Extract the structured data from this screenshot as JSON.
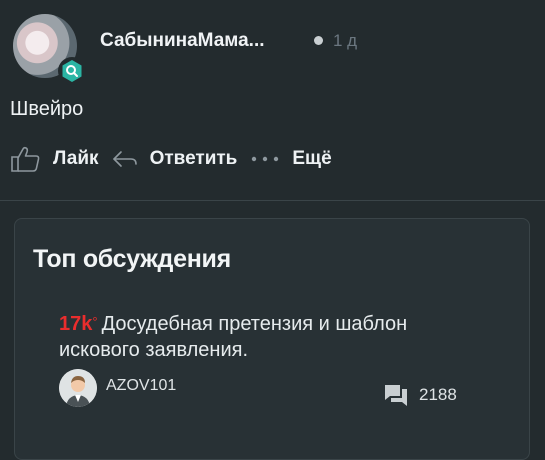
{
  "comment": {
    "author": "СабынинаМама...",
    "time": "1 д",
    "text": "Швейро",
    "actions": {
      "like_label": "Лайк",
      "reply_label": "Ответить",
      "more_label": "Ещё"
    }
  },
  "top_discussions": {
    "title": "Топ обсуждения",
    "items": [
      {
        "heat": "17k",
        "heat_mark": "°",
        "title": "Досудебная претензия и шаблон искового заявления.",
        "user": "AZOV101",
        "comments_count": "2188"
      }
    ]
  },
  "colors": {
    "background": "#232b2e",
    "card": "#283135",
    "heat": "#ea2d2d",
    "badge": "#2bb5a4"
  }
}
